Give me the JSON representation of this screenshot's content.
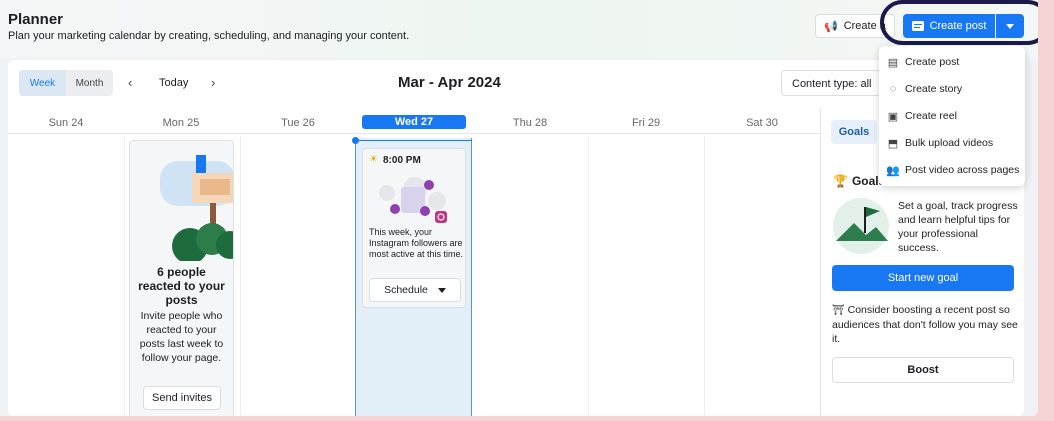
{
  "header": {
    "title": "Planner",
    "subtitle": "Plan your marketing calendar by creating, scheduling, and managing your content.",
    "create_ad_label": "Create a",
    "create_post_label": "Create post"
  },
  "toolbar": {
    "view_week": "Week",
    "view_month": "Month",
    "today": "Today",
    "range": "Mar - Apr 2024",
    "content_type": "Content type: all"
  },
  "days": [
    "Sun 24",
    "Mon 25",
    "Tue 26",
    "Wed 27",
    "Thu 28",
    "Fri 29",
    "Sat 30"
  ],
  "reaction_card": {
    "heading": "6 people reacted to your posts",
    "body": "Invite people who reacted to your posts last week to follow your page.",
    "button": "Send invites"
  },
  "insight_card": {
    "time": "8:00 PM",
    "text": "This week, your Instagram followers are most active at this time.",
    "button": "Schedule"
  },
  "side": {
    "tab": "Goals",
    "heading": "Goals",
    "goal_text": "Set a goal, track progress and learn helpful tips for your professional success.",
    "goal_button": "Start new goal",
    "boost_text": "Consider boosting a recent post so audiences that don't follow you may see it.",
    "boost_button": "Boost"
  },
  "menu": {
    "items": [
      "Create post",
      "Create story",
      "Create reel",
      "Bulk upload videos",
      "Post video across pages"
    ]
  },
  "colors": {
    "accent": "#1877f2",
    "highlight_ring": "#1c1a4a"
  }
}
